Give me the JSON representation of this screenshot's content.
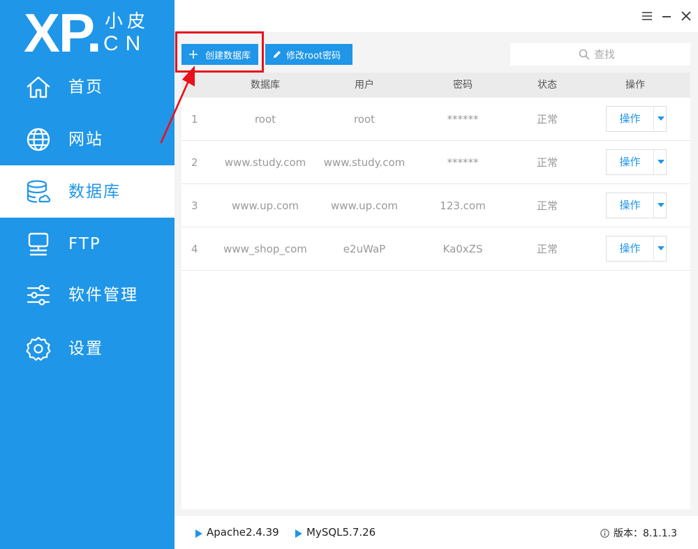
{
  "app": {
    "logo": {
      "xp": "XP.",
      "xiaopi": "小皮",
      "cn": "CN"
    }
  },
  "sidebar": {
    "items": [
      {
        "label": "首页",
        "icon": "home-icon",
        "active": false
      },
      {
        "label": "网站",
        "icon": "globe-icon",
        "active": false
      },
      {
        "label": "数据库",
        "icon": "database-icon",
        "active": true
      },
      {
        "label": "FTP",
        "icon": "monitor-icon",
        "active": false
      },
      {
        "label": "软件管理",
        "icon": "sliders-icon",
        "active": false
      },
      {
        "label": "设置",
        "icon": "gear-icon",
        "active": false
      }
    ]
  },
  "titlebar": {
    "controls": [
      "menu-icon",
      "minimize-icon",
      "close-icon"
    ]
  },
  "toolbar": {
    "create_label": "创建数据库",
    "change_root_label": "修改root密码"
  },
  "search": {
    "placeholder": "查找"
  },
  "table": {
    "headers": [
      "数据库",
      "用户",
      "密码",
      "状态",
      "操作"
    ],
    "rows": [
      {
        "index": "1",
        "database": "root",
        "user": "root",
        "password": "******",
        "status": "正常",
        "action": "操作"
      },
      {
        "index": "2",
        "database": "www.study.com",
        "user": "www.study.com",
        "password": "******",
        "status": "正常",
        "action": "操作"
      },
      {
        "index": "3",
        "database": "www.up.com",
        "user": "www.up.com",
        "password": "123.com",
        "status": "正常",
        "action": "操作"
      },
      {
        "index": "4",
        "database": "www_shop_com",
        "user": "e2uWaP",
        "password": "Ka0xZS",
        "status": "正常",
        "action": "操作"
      }
    ]
  },
  "footer": {
    "apache": "Apache2.4.39",
    "mysql": "MySQL5.7.26",
    "version": "版本：8.1.1.3"
  },
  "colors": {
    "brand": "#1f96e8",
    "highlight": "#e8101a"
  }
}
